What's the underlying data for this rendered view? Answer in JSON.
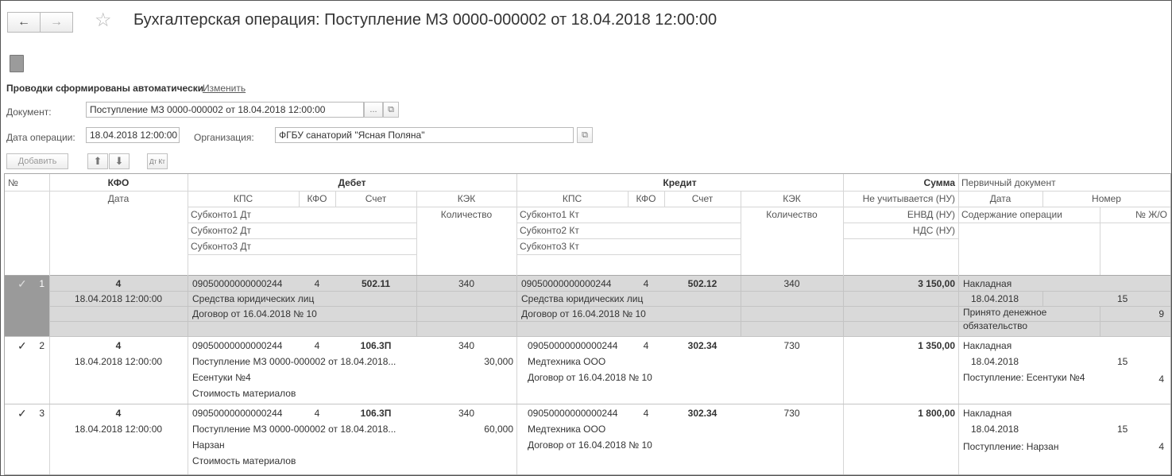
{
  "window": {
    "title": "Бухгалтерская операция: Поступление МЗ 0000-000002 от 18.04.2018 12:00:00",
    "back_label": "←",
    "forward_label": "→",
    "star_icon": "star-icon"
  },
  "status": {
    "text": "Проводки сформированы автоматически",
    "change_link": "Изменить"
  },
  "form": {
    "document_label": "Документ:",
    "document_value": "Поступление МЗ 0000-000002 от 18.04.2018 12:00:00",
    "dots_label": "...",
    "date_label": "Дата операции:",
    "date_value": "18.04.2018 12:00:00",
    "org_label": "Организация:",
    "org_value": "ФГБУ санаторий \"Ясная Поляна\""
  },
  "toolbar": {
    "add_label": "Добавить",
    "up_icon": "arrow-up-icon",
    "down_icon": "arrow-down-icon",
    "dtkt_label": "Дт Кт"
  },
  "table": {
    "header": {
      "no": "№",
      "kfo": "КФО",
      "debit": "Дебет",
      "credit": "Кредит",
      "sum": "Сумма",
      "primary_doc": "Первичный документ",
      "date": "Дата",
      "kps": "КПС",
      "kfo2": "КФО",
      "account": "Счет",
      "kek": "КЭК",
      "kps_k": "КПС",
      "kfo_k": "КФО",
      "account_k": "Счет",
      "kek_k": "КЭК",
      "not_counted": "Не учитывается (НУ)",
      "pd_date": "Дата",
      "pd_number": "Номер",
      "sub1_dt": "Субконто1 Дт",
      "qty_dt": "Количество",
      "sub1_kt": "Субконто1 Кт",
      "qty_kt": "Количество",
      "envd": "ЕНВД (НУ)",
      "op_content": "Содержание операции",
      "jo": "№ Ж/О",
      "sub2_dt": "Субконто2 Дт",
      "sub2_kt": "Субконто2 Кт",
      "nds": "НДС (НУ)",
      "sub3_dt": "Субконто3 Дт",
      "sub3_kt": "Субконто3 Кт"
    },
    "rows": [
      {
        "no": "1",
        "check": "✓",
        "kfo": "4",
        "date": "18.04.2018 12:00:00",
        "dt_kps": "09050000000000244",
        "dt_kfo": "4",
        "dt_account": "502.11",
        "dt_kek": "340",
        "dt_sub1": "Средства юридических лиц",
        "dt_sub2": "Договор от 16.04.2018 № 10",
        "dt_sub3": "",
        "dt_qty": "",
        "kt_kps": "09050000000000244",
        "kt_kfo": "4",
        "kt_account": "502.12",
        "kt_kek": "340",
        "kt_sub1": "Средства юридических лиц",
        "kt_sub2": "Договор от 16.04.2018 № 10",
        "kt_sub3": "",
        "sum": "3 150,00",
        "pd_doc": "Накладная",
        "pd_date": "18.04.2018",
        "pd_number": "15",
        "content": "Принято денежное обязательство",
        "jo": "9"
      },
      {
        "no": "2",
        "check": "✓",
        "kfo": "4",
        "date": "18.04.2018 12:00:00",
        "dt_kps": "09050000000000244",
        "dt_kfo": "4",
        "dt_account": "106.3П",
        "dt_kek": "340",
        "dt_sub1": "Поступление МЗ 0000-000002 от 18.04.2018...",
        "dt_qty": "30,000",
        "dt_sub2": "Есентуки №4",
        "dt_sub3": "Стоимость материалов",
        "kt_kps": "09050000000000244",
        "kt_kfo": "4",
        "kt_account": "302.34",
        "kt_kek": "730",
        "kt_sub1": "Медтехника ООО",
        "kt_sub2": "Договор от 16.04.2018 № 10",
        "kt_sub3": "",
        "sum": "1 350,00",
        "pd_doc": "Накладная",
        "pd_date": "18.04.2018",
        "pd_number": "15",
        "content": "Поступление: Есентуки №4",
        "jo": "4"
      },
      {
        "no": "3",
        "check": "✓",
        "kfo": "4",
        "date": "18.04.2018 12:00:00",
        "dt_kps": "09050000000000244",
        "dt_kfo": "4",
        "dt_account": "106.3П",
        "dt_kek": "340",
        "dt_sub1": "Поступление МЗ 0000-000002 от 18.04.2018...",
        "dt_qty": "60,000",
        "dt_sub2": "Нарзан",
        "dt_sub3": "Стоимость материалов",
        "kt_kps": "09050000000000244",
        "kt_kfo": "4",
        "kt_account": "302.34",
        "kt_kek": "730",
        "kt_sub1": "Медтехника ООО",
        "kt_sub2": "Договор от 16.04.2018 № 10",
        "kt_sub3": "",
        "sum": "1 800,00",
        "pd_doc": "Накладная",
        "pd_date": "18.04.2018",
        "pd_number": "15",
        "content": "Поступление: Нарзан",
        "jo": "4"
      }
    ]
  }
}
